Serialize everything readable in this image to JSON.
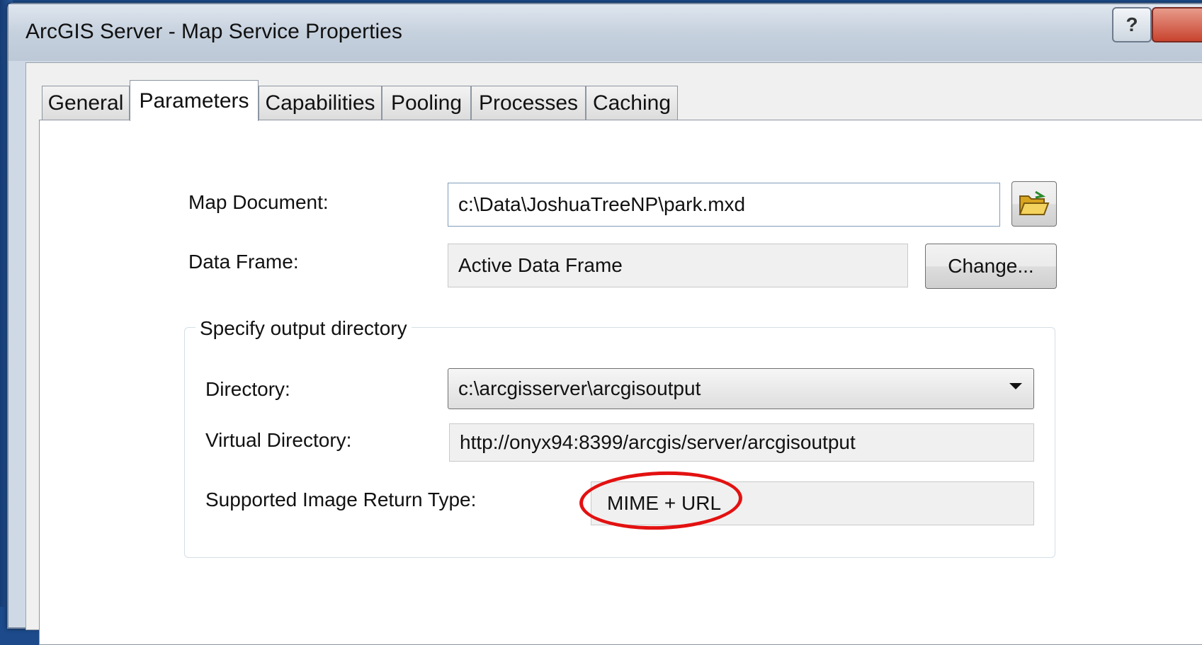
{
  "window": {
    "title": "ArcGIS Server - Map Service Properties",
    "help_glyph": "?"
  },
  "tabs": [
    {
      "label": "General",
      "active": false
    },
    {
      "label": "Parameters",
      "active": true
    },
    {
      "label": "Capabilities",
      "active": false
    },
    {
      "label": "Pooling",
      "active": false
    },
    {
      "label": "Processes",
      "active": false
    },
    {
      "label": "Caching",
      "active": false
    }
  ],
  "parameters": {
    "map_document_label": "Map Document:",
    "map_document_value": "c:\\Data\\JoshuaTreeNP\\park.mxd",
    "data_frame_label": "Data Frame:",
    "data_frame_value": "Active Data Frame",
    "change_button": "Change...",
    "output_group": {
      "caption": "Specify output directory",
      "directory_label": "Directory:",
      "directory_value": "c:\\arcgisserver\\arcgisoutput",
      "virtual_directory_label": "Virtual Directory:",
      "virtual_directory_value": "http://onyx94:8399/arcgis/server/arcgisoutput",
      "image_return_label": "Supported Image Return Type:",
      "image_return_value": "MIME + URL"
    }
  },
  "colors": {
    "annotation": "#e31111",
    "desktop": "#1c4a8a"
  }
}
